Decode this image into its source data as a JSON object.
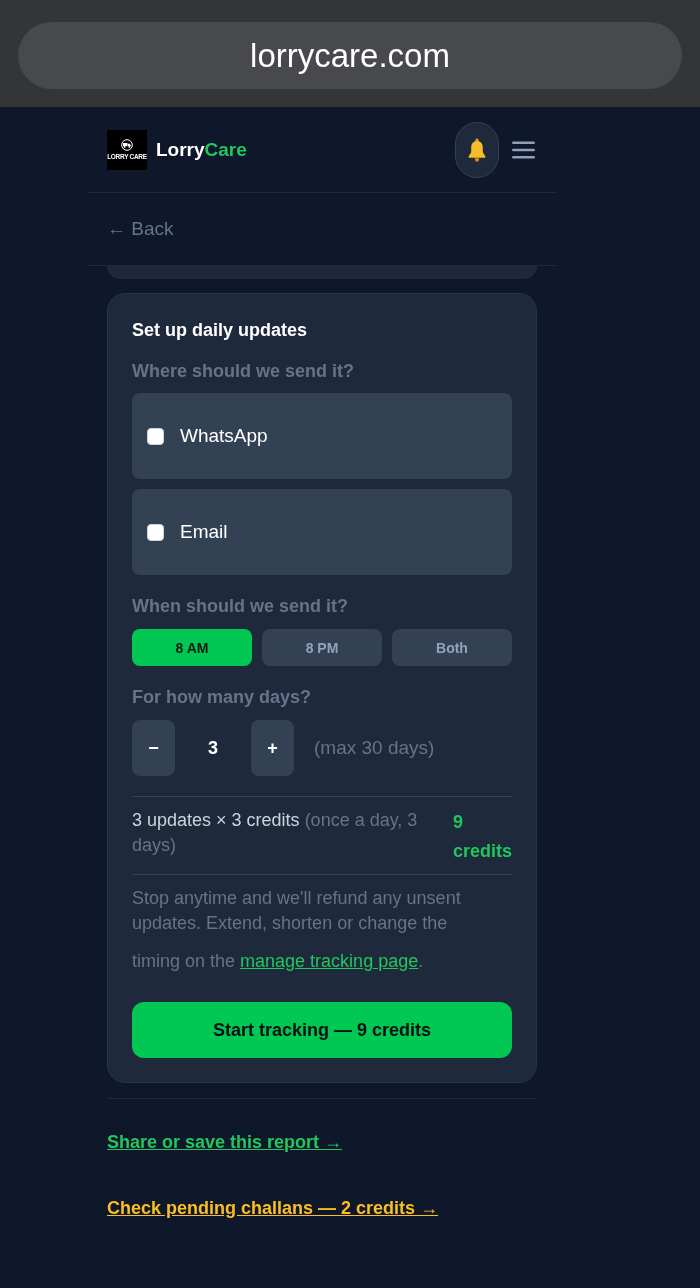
{
  "browser": {
    "url": "lorrycare.com"
  },
  "header": {
    "logo_text": "LORRY CARE",
    "brand": {
      "name": "Lorry",
      "accent": "Care"
    }
  },
  "back_link": {
    "label": "← Back"
  },
  "daily_updates": {
    "title": "Set up daily updates",
    "channel_label": "Where should we send it?",
    "channels": [
      {
        "label": "WhatsApp",
        "checked": false
      },
      {
        "label": "Email",
        "checked": false
      }
    ],
    "time_label": "When should we send it?",
    "times": [
      {
        "label": "8 AM",
        "selected": true
      },
      {
        "label": "8 PM",
        "selected": false
      },
      {
        "label": "Both",
        "selected": false
      }
    ],
    "days_label": "For how many days?",
    "days": {
      "decrement": "−",
      "value": "3",
      "increment": "+",
      "hint": "(max 30 days)"
    },
    "cost": {
      "breakdown": "3 updates × 3 credits",
      "detail": "(once a day, 3 days)",
      "total": "9 credits"
    },
    "note": {
      "text": "Stop anytime and we'll refund any unsent updates. Extend, shorten or change the timing on the",
      "link": "manage tracking page",
      "end": "."
    },
    "submit": "Start tracking — 9 credits"
  },
  "links": [
    {
      "label": "Share or save this report →",
      "kind": "share"
    },
    {
      "label": "Check pending challans — 2 credits →",
      "kind": "upsell"
    }
  ]
}
